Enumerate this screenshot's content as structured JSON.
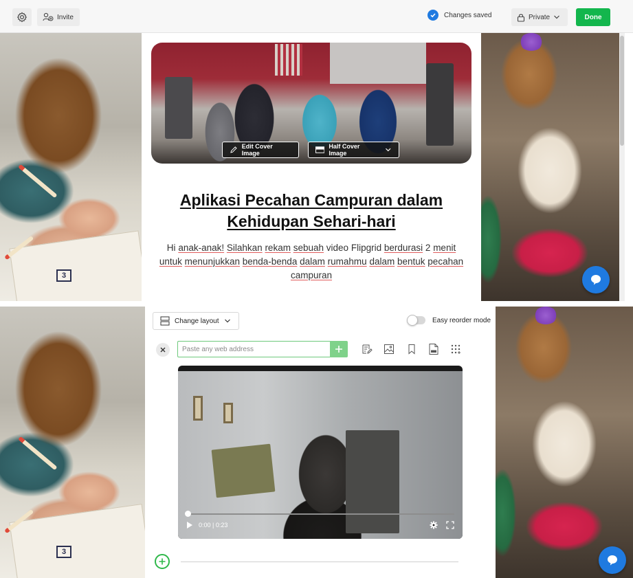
{
  "toolbar": {
    "invite_label": "Invite",
    "saved_label": "Changes saved",
    "privacy_label": "Private",
    "done_label": "Done"
  },
  "cover": {
    "edit_label": "Edit Cover Image",
    "half_label": "Half Cover Image"
  },
  "page": {
    "title": "Aplikasi Pecahan Campuran dalam Kehidupan Sehari-hari",
    "description": "Hi anak-anak! Silahkan rekam sebuah video Flipgrid berdurasi 2 menit untuk menunjukkan benda-benda dalam rumahmu dalam bentuk pecahan campuran"
  },
  "editor": {
    "layout_label": "Change layout",
    "reorder_label": "Easy reorder mode",
    "url_placeholder": "Paste any web address",
    "video_time": "0:00 | 0:23",
    "video_progress": 0.0
  },
  "background": {
    "number_badge": "3"
  },
  "colors": {
    "accent_blue": "#1f7ae0",
    "done_green": "#13b64d",
    "add_green": "#7fd28a"
  },
  "icons": {
    "settings": "gear-icon",
    "invite": "person-add-icon",
    "saved": "check-circle-icon",
    "privacy": "lock-icon",
    "chat": "chat-bubble-icon"
  }
}
